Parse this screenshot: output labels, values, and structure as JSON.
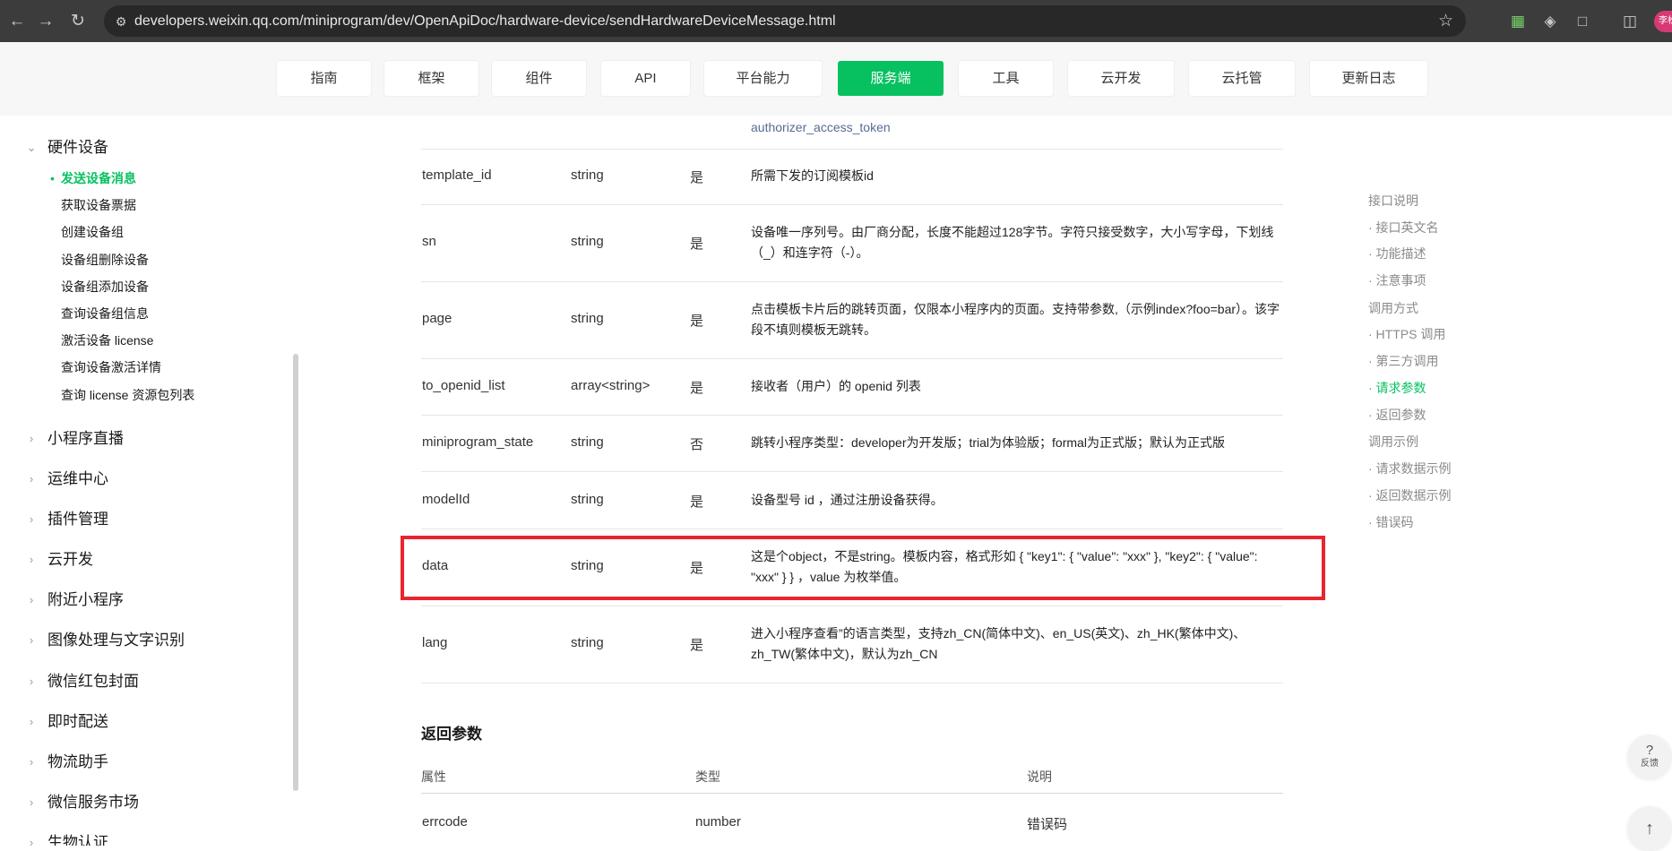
{
  "browser": {
    "url": "developers.weixin.qq.com/miniprogram/dev/OpenApiDoc/hardware-device/sendHardwareDeviceMessage.html",
    "profile_label": "李松"
  },
  "topnav": {
    "tabs": [
      "指南",
      "框架",
      "组件",
      "API",
      "平台能力",
      "服务端",
      "工具",
      "云开发",
      "云托管",
      "更新日志"
    ],
    "active": "服务端"
  },
  "sidebar": {
    "current_group": "硬件设备",
    "sub_items": [
      "发送设备消息",
      "获取设备票据",
      "创建设备组",
      "设备组删除设备",
      "设备组添加设备",
      "查询设备组信息",
      "激活设备 license",
      "查询设备激活详情",
      "查询 license 资源包列表"
    ],
    "active_sub": "发送设备消息",
    "groups": [
      "小程序直播",
      "运维中心",
      "插件管理",
      "云开发",
      "附近小程序",
      "图像处理与文字识别",
      "微信红包封面",
      "即时配送",
      "物流助手",
      "微信服务市场",
      "生物认证"
    ]
  },
  "params": {
    "partial_row_desc": "authorizer_access_token",
    "rows": [
      {
        "name": "template_id",
        "type": "string",
        "required": "是",
        "desc": "所需下发的订阅模板id"
      },
      {
        "name": "sn",
        "type": "string",
        "required": "是",
        "desc": "设备唯一序列号。由厂商分配，长度不能超过128字节。字符只接受数字，大小写字母，下划线（_）和连字符（-）。"
      },
      {
        "name": "page",
        "type": "string",
        "required": "是",
        "desc": "点击模板卡片后的跳转页面，仅限本小程序内的页面。支持带参数,（示例index?foo=bar）。该字段不填则模板无跳转。"
      },
      {
        "name": "to_openid_list",
        "type": "array<string>",
        "required": "是",
        "desc": "接收者（用户）的 openid 列表"
      },
      {
        "name": "miniprogram_state",
        "type": "string",
        "required": "否",
        "desc": "跳转小程序类型：developer为开发版；trial为体验版；formal为正式版；默认为正式版"
      },
      {
        "name": "modelId",
        "type": "string",
        "required": "是",
        "desc": "设备型号 id ，通过注册设备获得。"
      },
      {
        "name": "data",
        "type": "string",
        "required": "是",
        "desc": "这是个object，不是string。模板内容，格式形如 { \"key1\": { \"value\": \"xxx\" }, \"key2\": { \"value\": \"xxx\" } } ，value 为枚举值。"
      },
      {
        "name": "lang",
        "type": "string",
        "required": "是",
        "desc": "进入小程序查看”的语言类型，支持zh_CN(简体中文)、en_US(英文)、zh_HK(繁体中文)、zh_TW(繁体中文)，默认为zh_CN"
      }
    ]
  },
  "return_params": {
    "title": "返回参数",
    "headers": [
      "属性",
      "类型",
      "说明"
    ],
    "rows": [
      {
        "name": "errcode",
        "type": "number",
        "desc": "错误码"
      }
    ]
  },
  "toc": {
    "items": [
      "接口说明",
      "· 接口英文名",
      "· 功能描述",
      "· 注意事项",
      "调用方式",
      "· HTTPS 调用",
      "· 第三方调用",
      "· 请求参数",
      "· 返回参数",
      "调用示例",
      "· 请求数据示例",
      "· 返回数据示例",
      "· 错误码"
    ],
    "active_index": 7
  },
  "floating": {
    "feedback_label": "反馈",
    "feedback_icon": "?",
    "top_icon": "↑"
  },
  "colors": {
    "brand_green": "#07c160",
    "highlight_red": "#e8252f",
    "link": "#576b95"
  }
}
